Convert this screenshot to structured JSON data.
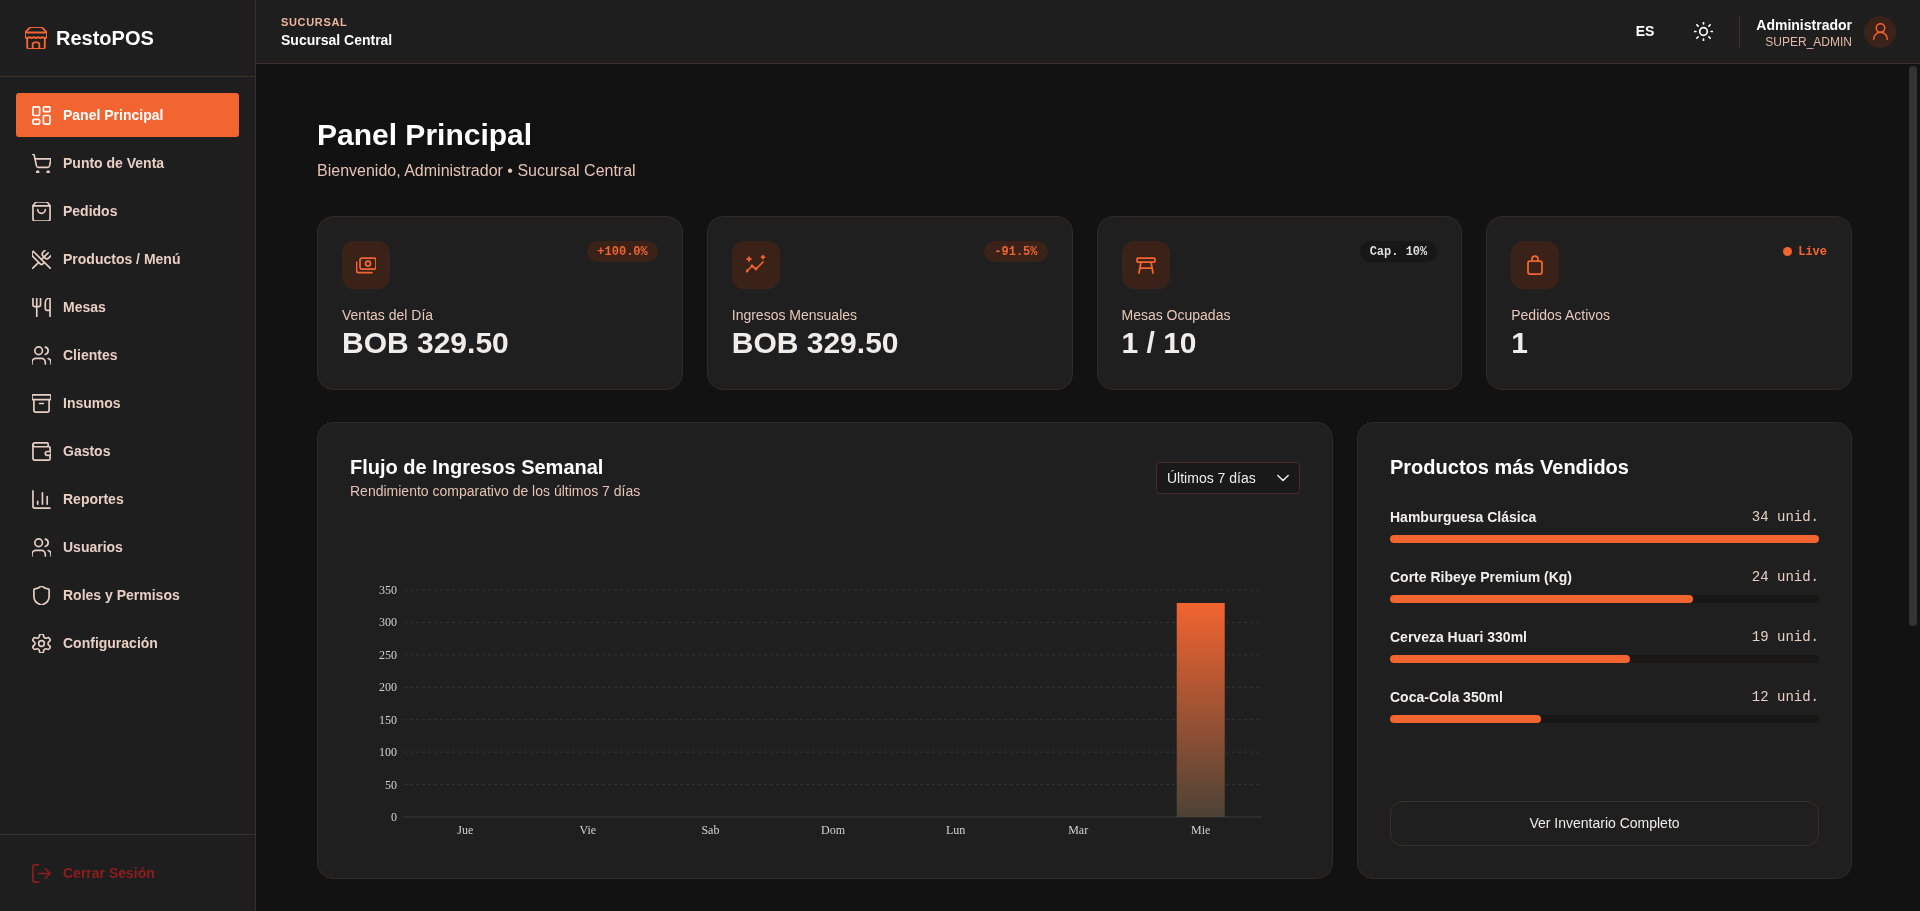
{
  "sidebar": {
    "brand": "RestoPOS",
    "items": [
      {
        "label": "Panel Principal",
        "selected": true
      },
      {
        "label": "Punto de Venta",
        "selected": false
      },
      {
        "label": "Pedidos",
        "selected": false
      },
      {
        "label": "Productos / Menú",
        "selected": false
      },
      {
        "label": "Mesas",
        "selected": false
      },
      {
        "label": "Clientes",
        "selected": false
      },
      {
        "label": "Insumos",
        "selected": false
      },
      {
        "label": "Gastos",
        "selected": false
      },
      {
        "label": "Reportes",
        "selected": false
      },
      {
        "label": "Usuarios",
        "selected": false
      },
      {
        "label": "Roles y Permisos",
        "selected": false
      },
      {
        "label": "Configuración",
        "selected": false
      }
    ],
    "logout": "Cerrar Sesión"
  },
  "header": {
    "branch_label": "SUCURSAL",
    "branch_name": "Sucursal Central",
    "language": "ES",
    "user": {
      "name": "Administrador",
      "role": "SUPER_ADMIN"
    }
  },
  "page": {
    "title": "Panel Principal",
    "subtitle": "Bienvenido, Administrador • Sucursal Central"
  },
  "stats": [
    {
      "label": "Ventas del Día",
      "value": "BOB 329.50",
      "badge": {
        "kind": "accent",
        "text": "+100.0%"
      }
    },
    {
      "label": "Ingresos Mensuales",
      "value": "BOB 329.50",
      "badge": {
        "kind": "accent",
        "text": "-91.5%"
      }
    },
    {
      "label": "Mesas Ocupadas",
      "value": "1 / 10",
      "badge": {
        "kind": "neutral",
        "text": "Cap. 10%"
      }
    },
    {
      "label": "Pedidos Activos",
      "value": "1",
      "badge": {
        "kind": "live",
        "text": "Live"
      }
    }
  ],
  "revenue_chart": {
    "title": "Flujo de Ingresos Semanal",
    "subtitle": "Rendimiento comparativo de los últimos 7 días",
    "range": {
      "value": "Últimos 7 días"
    },
    "chart_data": {
      "type": "bar",
      "categories": [
        "Jue",
        "Vie",
        "Sab",
        "Dom",
        "Lun",
        "Mar",
        "Mie"
      ],
      "values": [
        0,
        0,
        0,
        0,
        0,
        0,
        330
      ],
      "ylim": [
        0,
        350
      ],
      "yticks": [
        0,
        50,
        100,
        150,
        200,
        250,
        300,
        350
      ],
      "grid": true
    }
  },
  "top_products": {
    "title": "Productos más Vendidos",
    "items": [
      {
        "name": "Hamburguesa Clásica",
        "count": "34 unid.",
        "level": 1
      },
      {
        "name": "Corte Ribeye Premium (Kg)",
        "count": "24 unid.",
        "level": 0.706
      },
      {
        "name": "Cerveza Huari 330ml",
        "count": "19 unid.",
        "level": 0.559
      },
      {
        "name": "Coca-Cola 350ml",
        "count": "12 unid.",
        "level": 0.353
      }
    ],
    "button": "Ver Inventario Completo"
  }
}
